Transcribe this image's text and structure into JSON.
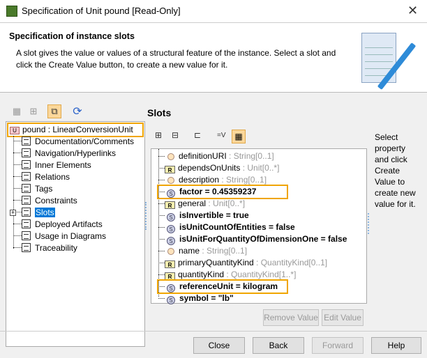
{
  "window": {
    "title": "Specification of Unit pound [Read-Only]"
  },
  "header": {
    "title": "Specification of instance slots",
    "description": "A slot gives the value or values of a structural feature of the instance. Select a slot and click the Create Value button, to create a new value for it."
  },
  "tree": {
    "root": "pound : LinearConversionUnit",
    "items": [
      "Documentation/Comments",
      "Navigation/Hyperlinks",
      "Inner Elements",
      "Relations",
      "Tags",
      "Constraints",
      "Slots",
      "Deployed Artifacts",
      "Usage in Diagrams",
      "Traceability"
    ],
    "selected": "Slots"
  },
  "slots": {
    "title": "Slots",
    "items": [
      {
        "name": "definitionURI",
        "type": " : String[0..1]",
        "kind": "c"
      },
      {
        "name": "dependsOnUnits",
        "type": " : Unit[0..*]",
        "kind": "r"
      },
      {
        "name": "description",
        "type": " : String[0..1]",
        "kind": "c"
      },
      {
        "name": "factor = 0.45359237",
        "type": "",
        "kind": "s"
      },
      {
        "name": "general",
        "type": " : Unit[0..*]",
        "kind": "r"
      },
      {
        "name": "isInvertible = true",
        "type": "",
        "kind": "s"
      },
      {
        "name": "isUnitCountOfEntities = false",
        "type": "",
        "kind": "s"
      },
      {
        "name": "isUnitForQuantityOfDimensionOne = false",
        "type": "",
        "kind": "s"
      },
      {
        "name": "name",
        "type": " : String[0..1]",
        "kind": "c"
      },
      {
        "name": "primaryQuantityKind",
        "type": " : QuantityKind[0..1]",
        "kind": "r"
      },
      {
        "name": "quantityKind",
        "type": " : QuantityKind[1..*]",
        "kind": "r"
      },
      {
        "name": "referenceUnit = kilogram",
        "type": "",
        "kind": "s"
      },
      {
        "name": "symbol = \"lb\"",
        "type": "",
        "kind": "s"
      }
    ],
    "help_text": "Select property and click Create Value to create new value for it.",
    "remove_value": "Remove Value",
    "edit_value": "Edit Value",
    "toolbar_value": "=V"
  },
  "buttons": {
    "close": "Close",
    "back": "Back",
    "forward": "Forward",
    "help": "Help"
  }
}
